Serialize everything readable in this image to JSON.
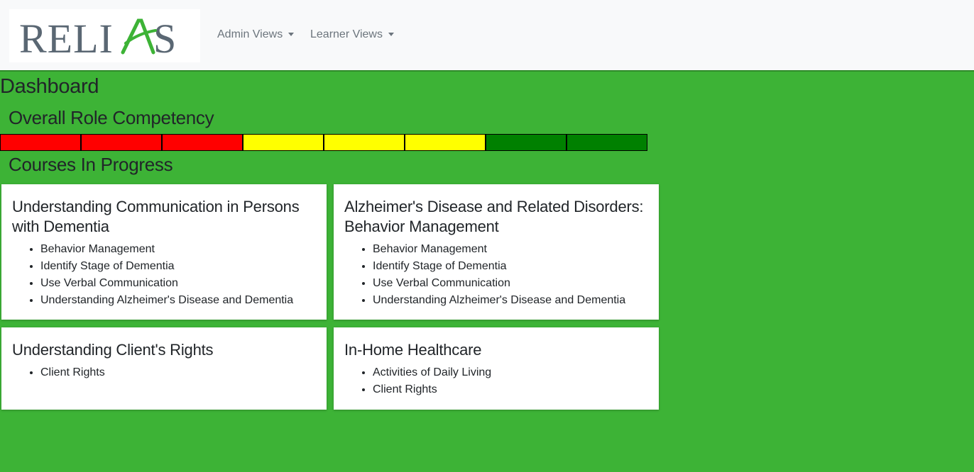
{
  "brand": {
    "logo_text": "RELIAS",
    "logo_colors": {
      "text": "#5a6773",
      "accent": "#3db336"
    }
  },
  "nav": {
    "admin_views": "Admin Views",
    "learner_views": "Learner Views"
  },
  "page": {
    "title": "Dashboard",
    "background": "#3db336"
  },
  "competency": {
    "title": "Overall Role Competency",
    "segments": [
      {
        "color": "#ff0000"
      },
      {
        "color": "#ff0000"
      },
      {
        "color": "#ff0000"
      },
      {
        "color": "#ffff00"
      },
      {
        "color": "#ffff00"
      },
      {
        "color": "#ffff00"
      },
      {
        "color": "#008000"
      },
      {
        "color": "#008000"
      }
    ]
  },
  "courses": {
    "title": "Courses In Progress",
    "items": [
      {
        "title": "Understanding Communication in Persons with Dementia",
        "skills": [
          "Behavior Management",
          "Identify Stage of Dementia",
          "Use Verbal Communication",
          "Understanding Alzheimer's Disease and Dementia"
        ]
      },
      {
        "title": "Alzheimer's Disease and Related Disorders: Behavior Management",
        "skills": [
          "Behavior Management",
          "Identify Stage of Dementia",
          "Use Verbal Communication",
          "Understanding Alzheimer's Disease and Dementia"
        ]
      },
      {
        "title": "Understanding Client's Rights",
        "skills": [
          "Client Rights"
        ]
      },
      {
        "title": "In-Home Healthcare",
        "skills": [
          "Activities of Daily Living",
          "Client Rights"
        ]
      }
    ]
  }
}
